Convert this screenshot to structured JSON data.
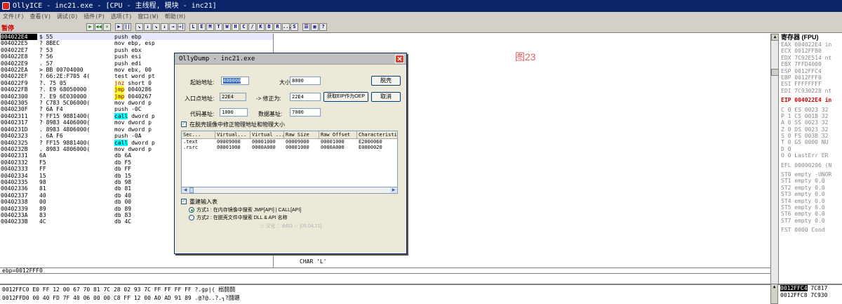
{
  "window": {
    "title": "OllyICE - inc21.exe - [CPU - 主线程, 模块 - inc21]"
  },
  "menu": [
    "文件(F)",
    "查看(V)",
    "调试(D)",
    "插件(P)",
    "选项(T)",
    "窗口(W)",
    "帮助(H)"
  ],
  "toolbar": {
    "status": "暂停",
    "buttons": [
      "▶",
      "◀◀",
      "✕",
      "▶",
      "||",
      "↘",
      "↓",
      "↘",
      "↓",
      "→",
      "→|",
      "L",
      "E",
      "M",
      "T",
      "W",
      "H",
      "C",
      "/",
      "K",
      "B",
      "R",
      "...",
      "S",
      "☰",
      "▦",
      "?"
    ]
  },
  "cpu": {
    "rows": [
      {
        "addr": "004022E4",
        "hex": "$  55",
        "cmd": "push    ebp",
        "sel": true
      },
      {
        "addr": "004022E5",
        "hex": "?  8BEC",
        "cmd": "mov     ebp, esp"
      },
      {
        "addr": "004022E7",
        "hex": "?  53",
        "cmd": "push    ebx"
      },
      {
        "addr": "004022E8",
        "hex": "?  56",
        "cmd": "push    esi"
      },
      {
        "addr": "004022E9",
        "hex": ".  57",
        "cmd": "push    edi"
      },
      {
        "addr": "004022EA",
        "hex": ">  BB 00704000",
        "cmd": "mov     ebx, 00"
      },
      {
        "addr": "004022EF",
        "hex": "?  66:2E:F705 4(",
        "cmd": "test    word pt"
      },
      {
        "addr": "004022F9",
        "hex": "?. 75 05",
        "cmd": "jnz     short 0",
        "kind": "jnz"
      },
      {
        "addr": "004022FB",
        "hex": "?. E9 68050000",
        "cmd": "jmp     0040286",
        "kind": "jmp"
      },
      {
        "addr": "00402300",
        "hex": "?. E9 6E030000",
        "cmd": "jmp     0040267",
        "kind": "jmp"
      },
      {
        "addr": "00402305",
        "hex": "?  C783 5C06000(",
        "cmd": "mov     dword p"
      },
      {
        "addr": "0040230F",
        "hex": "?  6A F4",
        "cmd": "push    -0C"
      },
      {
        "addr": "00402311",
        "hex": "?  FF15 9881400(",
        "cmd": "call    dword p",
        "kind": "call"
      },
      {
        "addr": "00402317",
        "hex": "?  8983 4406000(",
        "cmd": "mov     dword p"
      },
      {
        "addr": "0040231D",
        "hex": ".  8983 4806000(",
        "cmd": "mov     dword p"
      },
      {
        "addr": "00402323",
        "hex": ".  6A F6",
        "cmd": "push    -0A"
      },
      {
        "addr": "00402325",
        "hex": "?  FF15 9881400(",
        "cmd": "call    dword p",
        "kind": "call"
      },
      {
        "addr": "0040232B",
        "hex": ".  8983 4806000(",
        "cmd": "mov     dword p"
      },
      {
        "addr": "00402331",
        "hex": "   6A",
        "cmd": "db      6A"
      },
      {
        "addr": "00402332",
        "hex": "   F5",
        "cmd": "db      F5"
      },
      {
        "addr": "00402333",
        "hex": "   FF",
        "cmd": "db      FF"
      },
      {
        "addr": "00402334",
        "hex": "   15",
        "cmd": "db      15"
      },
      {
        "addr": "00402335",
        "hex": "   98",
        "cmd": "db      98"
      },
      {
        "addr": "00402336",
        "hex": "   81",
        "cmd": "db      81"
      },
      {
        "addr": "00402337",
        "hex": "   40",
        "cmd": "db      40"
      },
      {
        "addr": "00402338",
        "hex": "   00",
        "cmd": "db      00"
      },
      {
        "addr": "00402339",
        "hex": "   89",
        "cmd": "db      89"
      },
      {
        "addr": "0040233A",
        "hex": "   83",
        "cmd": "db      83"
      },
      {
        "addr": "0040233B",
        "hex": "   4C",
        "cmd": "db      4C"
      }
    ],
    "comments": [
      {
        "text": "CHAR 'L'"
      },
      {
        "text": "CHAR 'L'"
      }
    ]
  },
  "watermark": "图23",
  "registers": {
    "header": "寄存器 (FPU)",
    "rows": [
      {
        "t": "EAX 004022E4 in"
      },
      {
        "t": "ECX 0012FFB0"
      },
      {
        "t": "EDX 7C92E514 nt"
      },
      {
        "t": "EBX 7FFD4000"
      },
      {
        "t": "ESP 0012FFC4"
      },
      {
        "t": "EBP 0012FFF0"
      },
      {
        "t": "ESI FFFFFFFF"
      },
      {
        "t": "EDI 7C930228 nt"
      },
      {
        "t": ""
      },
      {
        "t": "EIP 004022E4 in",
        "hl": true
      },
      {
        "t": ""
      },
      {
        "t": "C 0  ES 0023 32"
      },
      {
        "t": "P 1  CS 001B 32"
      },
      {
        "t": "A 0  SS 0023 32"
      },
      {
        "t": "Z 0  DS 0023 32"
      },
      {
        "t": "S 0  FS 003B 32"
      },
      {
        "t": "T 0  GS 0000 NU"
      },
      {
        "t": "D 0"
      },
      {
        "t": "O 0  LastErr ER"
      },
      {
        "t": ""
      },
      {
        "t": "EFL 00000206 (N"
      },
      {
        "t": ""
      },
      {
        "t": "ST0 empty -UNOR"
      },
      {
        "t": "ST1 empty 0.0"
      },
      {
        "t": "ST2 empty 0.0"
      },
      {
        "t": "ST3 empty 0.0"
      },
      {
        "t": "ST4 empty 0.0"
      },
      {
        "t": "ST5 empty 0.0"
      },
      {
        "t": "ST6 empty 0.0"
      },
      {
        "t": "ST7 empty 0.0"
      },
      {
        "t": ""
      },
      {
        "t": "FST 0000  Cond"
      }
    ]
  },
  "infobar": "ebp=0012FFF0",
  "dump": [
    {
      "t": "0012FFC0 E0 FF 12 00 67 70 81 7C 28 02 93 7C FF FF FF FF ?.gp|( 榒鬪鬪",
      "sel": false
    },
    {
      "t": "0012FFD0 00 40 FD 7F 40 06 00 00 C8 FF 12 00 A0 AD 91 89 .@?@..?.┐?鬪聰"
    }
  ],
  "stack": [
    {
      "a": "0012FFC4",
      "v": "7C817"
    },
    {
      "a": "0012FFC8",
      "v": "7C930"
    }
  ],
  "dialog": {
    "title": "OllyDump - inc21.exe",
    "close": "✕",
    "start_label": "起始地址:",
    "start_value": "400000",
    "size_label": "大小:",
    "size_value": "8000",
    "dump_btn": "脱壳",
    "ep_label": "入口点地址:",
    "ep_value": "22E4",
    "fix_label": "-> 修正为:",
    "fix_value": "22E4",
    "geteip_btn": "获取EIP作为OEP",
    "cancel_btn": "取消",
    "code_label": "代码基址:",
    "code_value": "1000",
    "data_label": "数据基址:",
    "data_value": "7000",
    "fix_raw_label": "在脱壳镜像中修正物理地址和物理大小",
    "columns": [
      "Sec...",
      "Virtual...",
      "Virtual ...",
      "Raw Size",
      "Raw Offset",
      "Characteristi"
    ],
    "sections": [
      [
        ".text",
        "00009000",
        "00001000",
        "00009000",
        "00001000",
        "E2000060"
      ],
      [
        ".rsrc",
        "00001000",
        "0000A000",
        "00001000",
        "0000A000",
        "E0000020"
      ]
    ],
    "rebuild_label": "重建输入表",
    "method1": "方式1 : 在内存镜像中搜索 JMP[API] | CALL[API]",
    "method2": "方式2 : 在脱壳文件中搜索 DLL & API 名称",
    "footer": "☆ 汉化 ：dd53 ☆ [05.04.21]"
  }
}
